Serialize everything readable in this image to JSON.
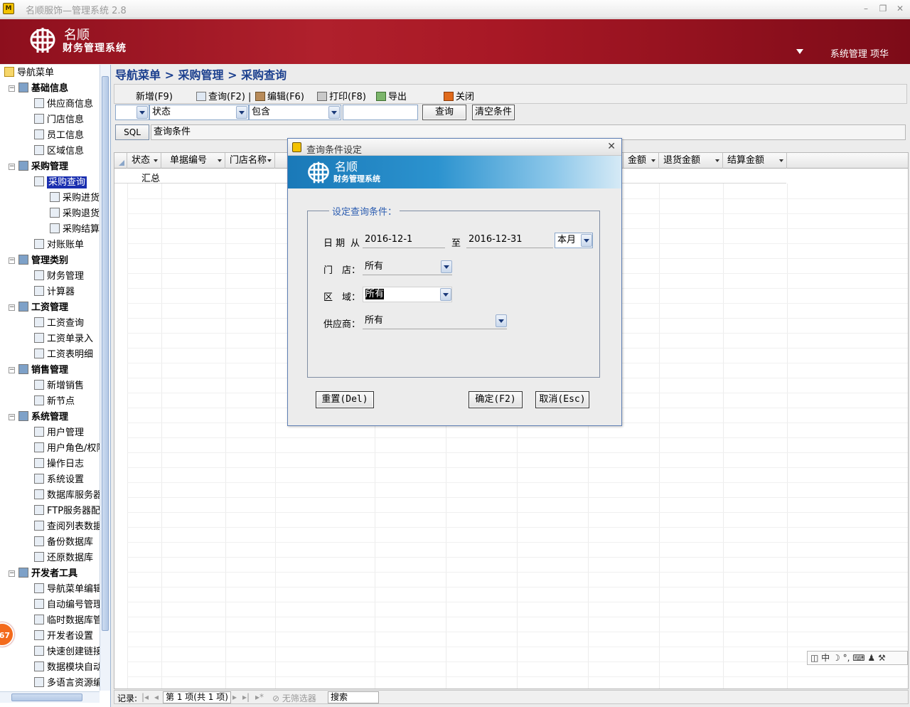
{
  "window": {
    "title": "名顺服饰—管理系统 2.8"
  },
  "banner": {
    "brand_name": "名顺",
    "brand_subtitle": "财务管理系统",
    "user": "系统管理 项华"
  },
  "breadcrumb": "导航菜单 > 采购管理 > 采购查询",
  "sidebar": {
    "root": "导航菜单",
    "items": [
      {
        "label": "基础信息",
        "level": 0
      },
      {
        "label": "供应商信息",
        "level": 1
      },
      {
        "label": "门店信息",
        "level": 1
      },
      {
        "label": "员工信息",
        "level": 1
      },
      {
        "label": "区域信息",
        "level": 1
      },
      {
        "label": "采购管理",
        "level": 0
      },
      {
        "label": "采购查询",
        "level": 1
      },
      {
        "label": "采购进货",
        "level": 2
      },
      {
        "label": "采购退货",
        "level": 2
      },
      {
        "label": "采购结算",
        "level": 2
      },
      {
        "label": "对账账单",
        "level": 1
      },
      {
        "label": "管理类别",
        "level": 0
      },
      {
        "label": "财务管理",
        "level": 1
      },
      {
        "label": "计算器",
        "level": 1
      },
      {
        "label": "工资管理",
        "level": 0
      },
      {
        "label": "工资查询",
        "level": 1
      },
      {
        "label": "工资单录入",
        "level": 1
      },
      {
        "label": "工资表明细",
        "level": 1
      },
      {
        "label": "销售管理",
        "level": 0
      },
      {
        "label": "新增销售",
        "level": 1
      },
      {
        "label": "新节点",
        "level": 1
      },
      {
        "label": "系统管理",
        "level": 0
      },
      {
        "label": "用户管理",
        "level": 1
      },
      {
        "label": "用户角色/权限",
        "level": 1
      },
      {
        "label": "操作日志",
        "level": 1
      },
      {
        "label": "系统设置",
        "level": 1
      },
      {
        "label": "数据库服务器",
        "level": 1
      },
      {
        "label": "FTP服务器配置",
        "level": 1
      },
      {
        "label": "查阅列表数据",
        "level": 1
      },
      {
        "label": "备份数据库",
        "level": 1
      },
      {
        "label": "还原数据库",
        "level": 1
      },
      {
        "label": "开发者工具",
        "level": 0
      },
      {
        "label": "导航菜单编辑",
        "level": 1
      },
      {
        "label": "自动编号管理",
        "level": 1
      },
      {
        "label": "临时数据库管理",
        "level": 1
      },
      {
        "label": "开发者设置",
        "level": 1
      },
      {
        "label": "快速创建链接",
        "level": 1
      },
      {
        "label": "数据模块自动",
        "level": 1
      },
      {
        "label": "多语言资源编辑",
        "level": 1
      }
    ],
    "selected": "采购查询",
    "badge": "67"
  },
  "toolbar": {
    "new": "新增(F9)",
    "query": "查询(F2) |",
    "edit": "编辑(F6)",
    "print": "打印(F8)",
    "export": "导出",
    "close": "关闭"
  },
  "filter": {
    "field": "状态",
    "op": "包含",
    "value": "",
    "query_btn": "查询",
    "clear_btn": "清空条件"
  },
  "sql": {
    "button": "SQL",
    "text": "查询条件"
  },
  "grid": {
    "columns": [
      "状态",
      "单据编号",
      "门店名称",
      "金额",
      "退货金额",
      "结算金额"
    ],
    "summary_label": "汇总"
  },
  "statusbar": {
    "records_label": "记录:",
    "page": "第 1 项(共 1 项)",
    "no_filter": "无筛选器",
    "search": "搜索"
  },
  "ime": "中",
  "dialog": {
    "title": "查询条件设定",
    "brand_name": "名顺",
    "brand_subtitle": "财务管理系统",
    "group_label": "设定查询条件：",
    "date_label": "日 期",
    "from_label": "从",
    "to_label": "至",
    "date_from": "2016-12-1",
    "date_to": "2016-12-31",
    "period": "本月",
    "store_label": "门　店：",
    "store_value": "所有",
    "region_label": "区　域：",
    "region_value": "所有",
    "supplier_label": "供应商：",
    "supplier_value": "所有",
    "reset_btn": "重置(Del)",
    "ok_btn": "确定(F2)",
    "cancel_btn": "取消(Esc)"
  }
}
